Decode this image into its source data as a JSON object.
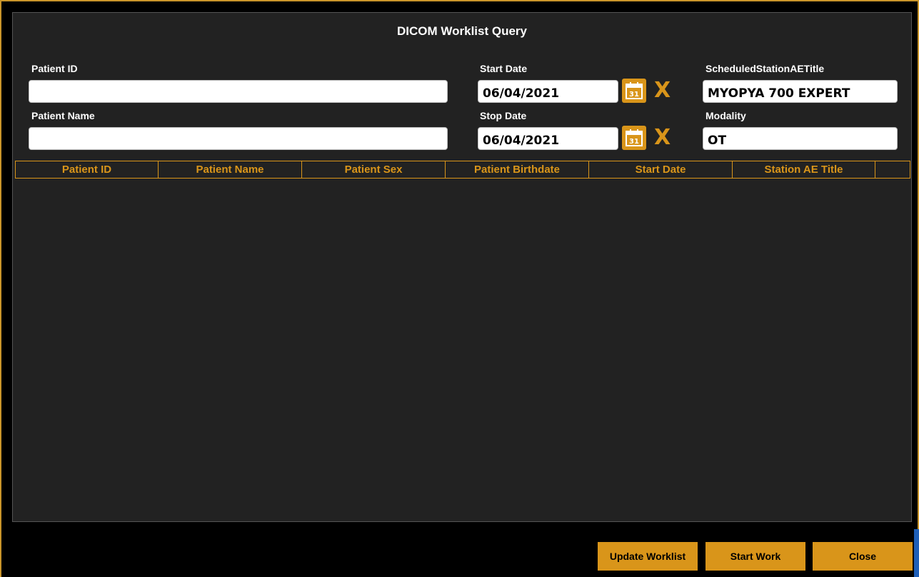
{
  "window": {
    "title": "DICOM Worklist Query"
  },
  "form": {
    "patient_id": {
      "label": "Patient ID",
      "value": ""
    },
    "patient_name": {
      "label": "Patient Name",
      "value": ""
    },
    "start_date": {
      "label": "Start Date",
      "value": "06/04/2021",
      "clear": "X"
    },
    "stop_date": {
      "label": "Stop Date",
      "value": "06/04/2021",
      "clear": "X"
    },
    "station_ae_title": {
      "label": "ScheduledStationAETitle",
      "value": "MYOPYA 700 EXPERT"
    },
    "modality": {
      "label": "Modality",
      "value": "OT"
    }
  },
  "calendar_icon_text": "31",
  "table": {
    "columns": [
      "Patient ID",
      "Patient Name",
      "Patient Sex",
      "Patient Birthdate",
      "Start Date",
      "Station AE Title"
    ],
    "rows": []
  },
  "buttons": {
    "update_worklist": "Update Worklist",
    "start_work": "Start Work",
    "close": "Close"
  },
  "colors": {
    "accent": "#d9951a",
    "panel_bg": "#222222",
    "window_bg": "#000000"
  }
}
